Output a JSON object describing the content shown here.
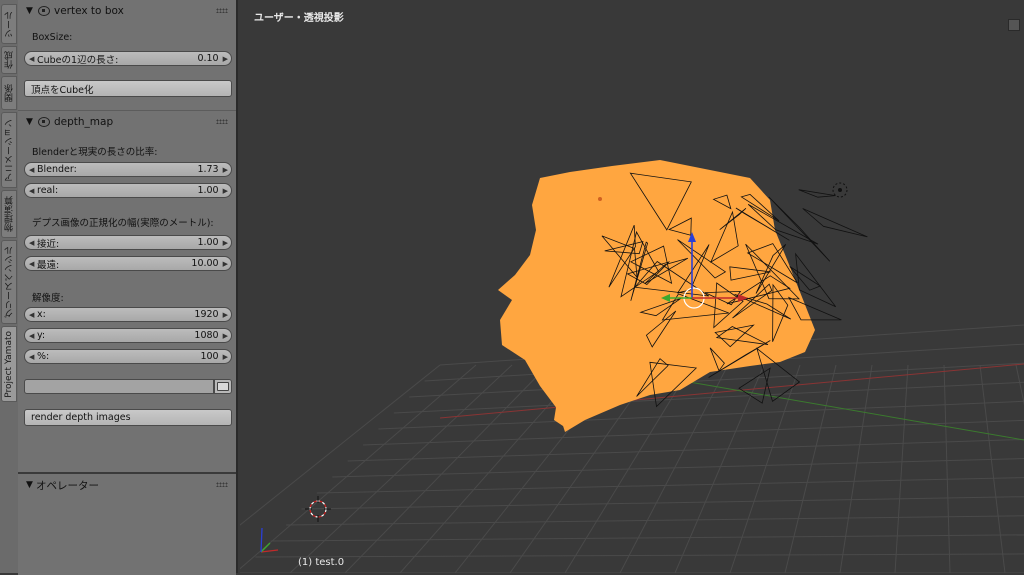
{
  "tabs": [
    {
      "label": "ツール",
      "active": false
    },
    {
      "label": "作成",
      "active": false
    },
    {
      "label": "関係",
      "active": false
    },
    {
      "label": "アニメーション",
      "active": false
    },
    {
      "label": "物理演算",
      "active": false
    },
    {
      "label": "グリースペンシル",
      "active": false
    },
    {
      "label": "Project Yamato",
      "active": true
    }
  ],
  "vertex_to_box": {
    "title": "vertex to box",
    "boxsize_label": "BoxSize:",
    "cube_side": {
      "name": "Cubeの1辺の長さ:",
      "value": "0.10"
    },
    "convert_button": "頂点をCube化"
  },
  "depth_map": {
    "title": "depth_map",
    "ratio_label": "Blenderと現実の長さの比率:",
    "blender": {
      "name": "Blender:",
      "value": "1.73"
    },
    "real": {
      "name": "real:",
      "value": "1.00"
    },
    "normalize_label": "デプス画像の正規化の幅(実際のメートル):",
    "near": {
      "name": "接近:",
      "value": "1.00"
    },
    "far": {
      "name": "最遠:",
      "value": "10.00"
    },
    "resolution_label": "解像度:",
    "res_x": {
      "name": "x:",
      "value": "1920"
    },
    "res_y": {
      "name": "y:",
      "value": "1080"
    },
    "res_pct": {
      "name": "%:",
      "value": "100"
    },
    "path_value": "",
    "render_button": "render depth images"
  },
  "operator_panel": {
    "title": "オペレーター"
  },
  "viewport": {
    "title": "ユーザー・透視投影",
    "object_label": "(1) test.0"
  },
  "colors": {
    "pointcloud": "#ffa640",
    "x_axis": "#b33a3a",
    "y_axis": "#3d8f2e",
    "z_axis": "#2a3fd6"
  }
}
